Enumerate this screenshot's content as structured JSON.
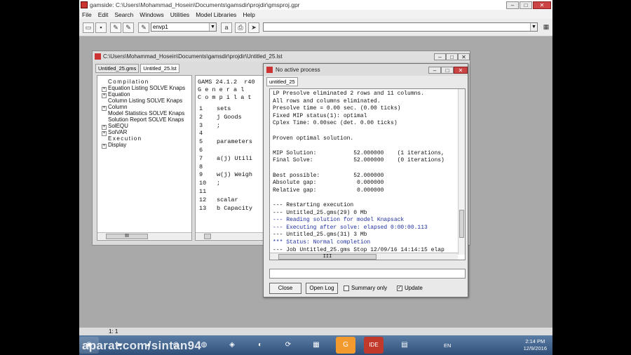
{
  "app": {
    "title": "gamside: C:\\Users\\Mohammad_Hosein\\Documents\\gamsdir\\projdir\\gmsproj.gpr",
    "menu": [
      "File",
      "Edit",
      "Search",
      "Windows",
      "Utilities",
      "Model Libraries",
      "Help"
    ],
    "toolbar": {
      "combo_value": "envp1",
      "a_label": "a"
    }
  },
  "listing_window": {
    "title": "C:\\Users\\Mohammad_Hosein\\Documents\\gamsdir\\projdir\\Untitled_25.lst",
    "tabs": [
      "Untitled_25.gms",
      "Untitled_25.lst"
    ],
    "tree": [
      {
        "label": "Compilation",
        "expand": false,
        "caps": true
      },
      {
        "label": "Equation Listing   SOLVE Knaps",
        "expand": true
      },
      {
        "label": "Equation",
        "expand": true
      },
      {
        "label": "Column Listing   SOLVE Knaps",
        "expand": false
      },
      {
        "label": "Column",
        "expand": true
      },
      {
        "label": "Model Statistics   SOLVE Knaps",
        "expand": false
      },
      {
        "label": "Solution Report   SOLVE Knaps",
        "expand": false
      },
      {
        "label": "SolEQU",
        "expand": true
      },
      {
        "label": "SolVAR",
        "expand": true
      },
      {
        "label": "Execution",
        "expand": false,
        "caps": true
      },
      {
        "label": "Display",
        "expand": true
      }
    ],
    "code_header": [
      "GAMS 24.1.2  r40",
      "G e n e r a l",
      "C o m p i l a t"
    ],
    "code_lines": [
      {
        "n": "1",
        "t": "sets"
      },
      {
        "n": "2",
        "t": "j Goods"
      },
      {
        "n": "3",
        "t": ";"
      },
      {
        "n": "4",
        "t": ""
      },
      {
        "n": "5",
        "t": "parameters"
      },
      {
        "n": "6",
        "t": ""
      },
      {
        "n": "7",
        "t": "a(j) Utili"
      },
      {
        "n": "8",
        "t": ""
      },
      {
        "n": "9",
        "t": "w(j) Weigh"
      },
      {
        "n": "10",
        "t": ";"
      },
      {
        "n": "11",
        "t": ""
      },
      {
        "n": "12",
        "t": "scalar"
      },
      {
        "n": "13",
        "t": "b Capacity"
      }
    ]
  },
  "process_dialog": {
    "title": "No active process",
    "tab": "untitled_25",
    "log_lines": [
      {
        "t": "LP Presolve eliminated 2 rows and 11 columns.",
        "blue": false
      },
      {
        "t": "All rows and columns eliminated.",
        "blue": false
      },
      {
        "t": "Presolve time = 0.00 sec. (0.00 ticks)",
        "blue": false
      },
      {
        "t": "Fixed MIP status(1): optimal",
        "blue": false
      },
      {
        "t": "Cplex Time: 0.00sec (det. 0.00 ticks)",
        "blue": false
      },
      {
        "t": "",
        "blue": false
      },
      {
        "t": "Proven optimal solution.",
        "blue": false
      },
      {
        "t": "",
        "blue": false
      },
      {
        "t": "MIP Solution:           52.000000    (1 iterations,",
        "blue": false
      },
      {
        "t": "Final Solve:            52.000000    (0 iterations)",
        "blue": false
      },
      {
        "t": "",
        "blue": false
      },
      {
        "t": "Best possible:          52.000000",
        "blue": false
      },
      {
        "t": "Absolute gap:            0.000000",
        "blue": false
      },
      {
        "t": "Relative gap:            0.000000",
        "blue": false
      },
      {
        "t": "",
        "blue": false
      },
      {
        "t": "--- Restarting execution",
        "blue": false
      },
      {
        "t": "--- Untitled_25.gms(29) 0 Mb",
        "blue": false
      },
      {
        "t": "--- Reading solution for model Knapsack",
        "blue": true
      },
      {
        "t": "--- Executing after solve: elapsed 0:00:00.113",
        "blue": true
      },
      {
        "t": "--- Untitled_25.gms(31) 3 Mb",
        "blue": false
      },
      {
        "t": "*** Status: Normal completion",
        "blue": true
      },
      {
        "t": "--- Job Untitled_25.gms Stop 12/09/16 14:14:15 elap",
        "blue": false
      }
    ],
    "close_label": "Close",
    "open_log_label": "Open Log",
    "summary_only_label": "Summary only",
    "summary_only_checked": false,
    "update_label": "Update",
    "update_checked": true
  },
  "status_bar": {
    "position": "1: 1"
  },
  "taskbar": {
    "watermark": "aparat.com/sintan94",
    "lang": "EN",
    "time": "2:14 PM",
    "date": "12/9/2016",
    "apps": [
      "Windows Explorer",
      "Firefox",
      "Chrome",
      "Skype",
      "Media",
      "Update",
      "Calculator",
      "GAMS",
      "IDE",
      "Windows Media",
      "Notepad"
    ]
  }
}
